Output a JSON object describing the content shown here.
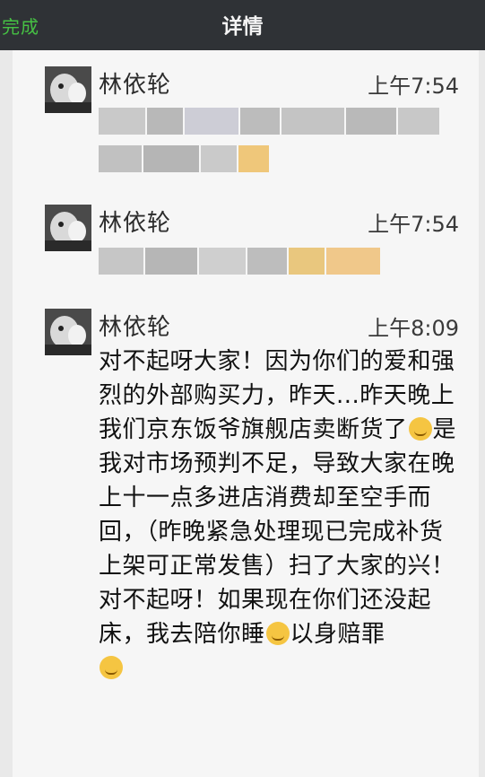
{
  "header": {
    "done_label": "完成",
    "title": "详情"
  },
  "messages": [
    {
      "sender": "林依轮",
      "time": "上午7:54",
      "blurred": true
    },
    {
      "sender": "林依轮",
      "time": "上午7:54",
      "blurred": true
    },
    {
      "sender": "林依轮",
      "time": "上午8:09",
      "blurred": false,
      "text_parts": [
        "对不起呀大家！因为你们的爱和强烈的外部购买力，昨天...昨天晚上我们京东饭爷旗舰店卖断货了",
        "是我对市场预判不足，导致大家在晚上十一点多进店消费却至空手而回，（昨晚紧急处理现已完成补货上架可正常发售）扫了大家的兴！对不起呀！如果现在你们还没起床，我去陪你睡",
        "以身赔罪"
      ],
      "emojis": [
        "smirk-emoji",
        "sunglasses-emoji",
        "sweat-emoji"
      ]
    }
  ]
}
